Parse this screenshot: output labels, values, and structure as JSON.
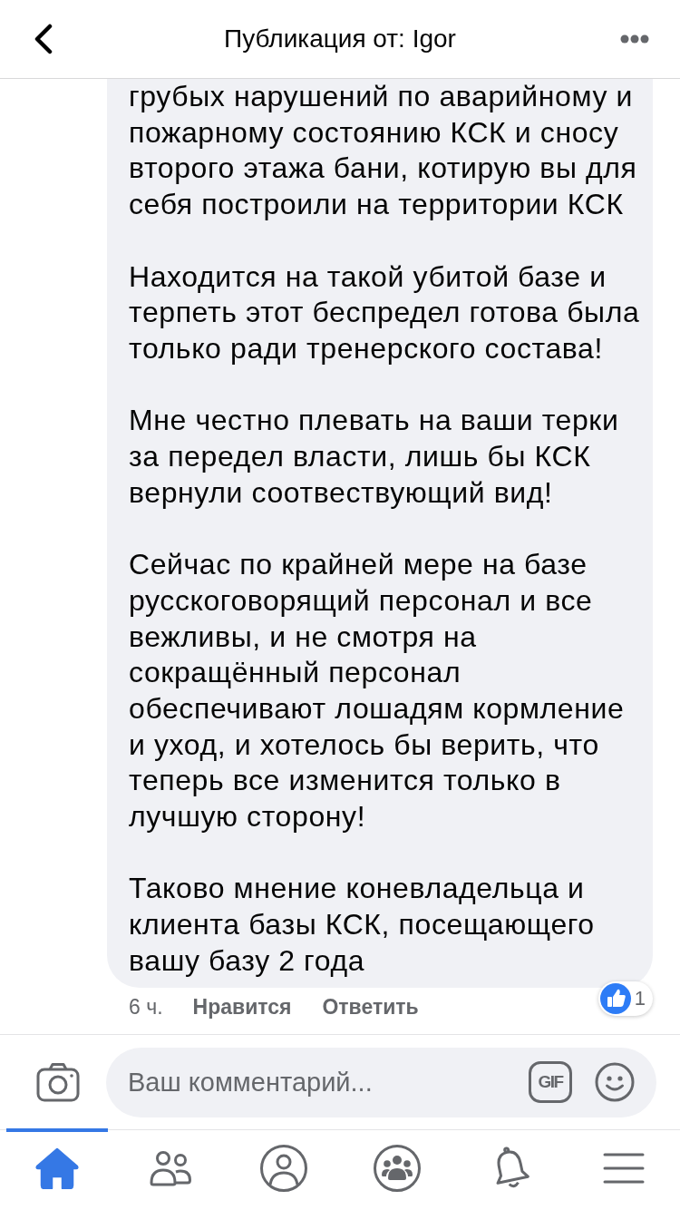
{
  "header": {
    "title": "Публикация от: Igor"
  },
  "comment": {
    "paragraphs": [
      "грубых нарушений по аварийному и пожарному состоянию КСК и сносу второго этажа бани, котирую вы для себя построили на территории КСК",
      "Находится на такой убитой базе и терпеть этот беспредел готова была только ради тренерского состава!",
      "Мне честно плевать на ваши терки за передел власти, лишь бы КСК вернули соотвествующий вид!",
      "Сейчас по крайней мере на базе русскоговорящий персонал и все вежливы, и не смотря на сокращённый персонал обеспечивают лошадям кормление и уход, и хотелось бы верить, что теперь все изменится только в лучшую сторону!",
      "Таково мнение коневладельца и клиента базы КСК, посещающего вашу базу 2 года"
    ],
    "time": "6 ч.",
    "actions": [
      "Нравится",
      "Ответить"
    ],
    "reactions": {
      "count": "1"
    }
  },
  "composer": {
    "placeholder": "Ваш комментарий...",
    "gif_label": "GIF"
  },
  "tab_bar": [
    {
      "kind": "home",
      "selected": true
    },
    {
      "kind": "friends",
      "selected": false
    },
    {
      "kind": "profile",
      "selected": false
    },
    {
      "kind": "groups",
      "selected": false
    },
    {
      "kind": "notifications",
      "selected": false
    },
    {
      "kind": "menu",
      "selected": false
    }
  ]
}
